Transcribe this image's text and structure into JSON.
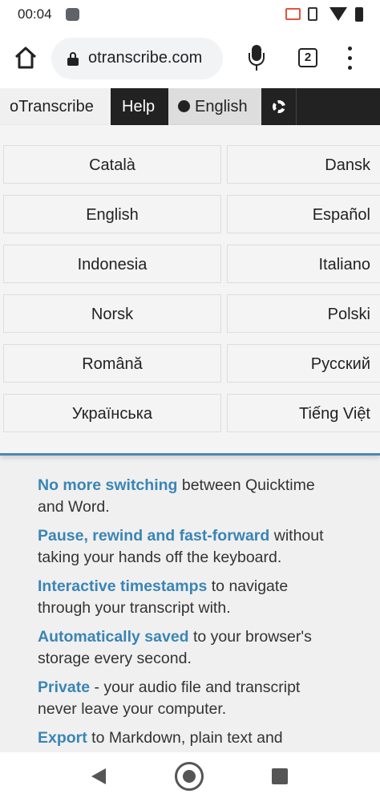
{
  "status_bar": {
    "time": "00:04"
  },
  "browser": {
    "url": "otranscribe.com",
    "tab_count": "2"
  },
  "topnav": {
    "brand": "oTranscribe",
    "help": "Help",
    "language": "English"
  },
  "languages": {
    "left": [
      "Català",
      "English",
      "Indonesia",
      "Norsk",
      "Română",
      "Українська"
    ],
    "right": [
      "Dansk",
      "Español",
      "Italiano",
      "Polski",
      "Русский",
      "Tiếng Việt"
    ]
  },
  "features": [
    {
      "highlight": "No more switching",
      "rest": " between Quicktime and Word."
    },
    {
      "highlight": "Pause, rewind and fast-forward",
      "rest": " without taking your hands off the keyboard."
    },
    {
      "highlight": "Interactive timestamps",
      "rest": " to navigate through your transcript with."
    },
    {
      "highlight": "Automatically saved",
      "rest": " to your browser's storage every second."
    },
    {
      "highlight": "Private",
      "rest": " - your audio file and transcript never leave your computer."
    },
    {
      "highlight": "Export",
      "rest": " to Markdown, plain text and"
    }
  ],
  "colors": {
    "accent": "#3a85b5",
    "nav_dark": "#222222",
    "recording_icon": "#e2543e"
  }
}
